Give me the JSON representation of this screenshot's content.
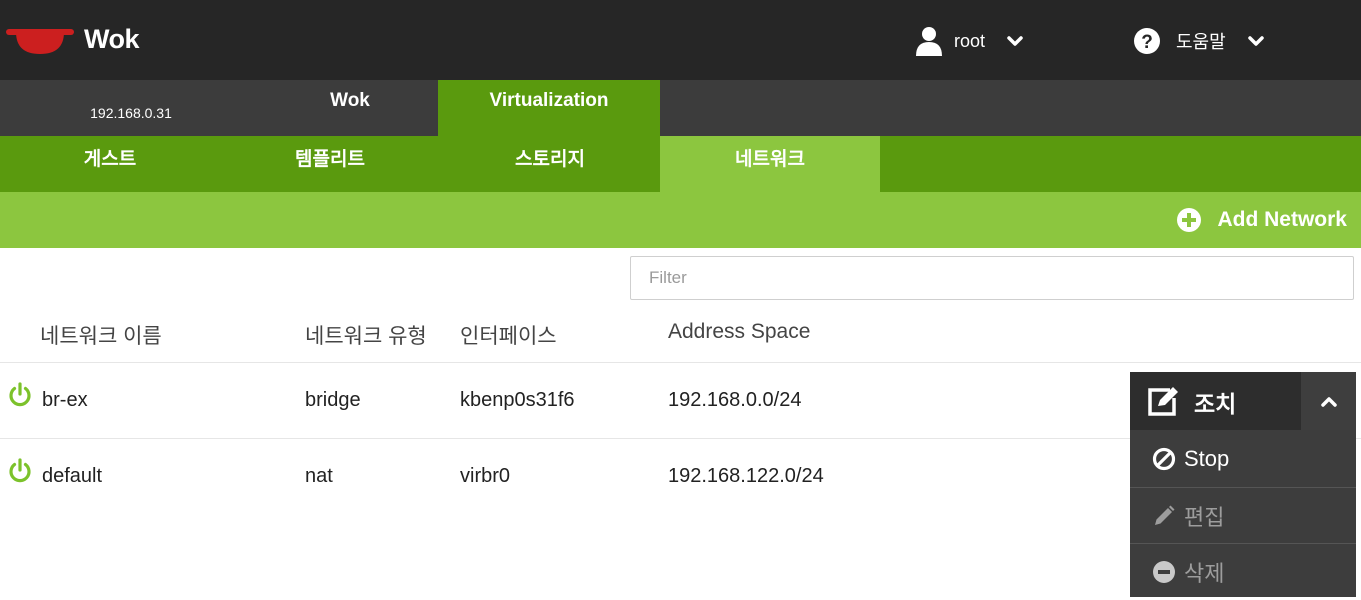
{
  "header": {
    "brand": "Wok",
    "user_label": "root",
    "help_label": "도움말"
  },
  "host_tabs": {
    "host_ip": "192.168.0.31",
    "wok": "Wok",
    "virtualization": "Virtualization"
  },
  "sub_tabs": {
    "guests": "게스트",
    "templates": "템플리트",
    "storage": "스토리지",
    "network": "네트워크"
  },
  "actions_bar": {
    "add_network": "Add Network"
  },
  "filter": {
    "placeholder": "Filter",
    "value": ""
  },
  "table": {
    "headers": {
      "name": "네트워크 이름",
      "type": "네트워크 유형",
      "interface": "인터페이스",
      "address": "Address Space"
    },
    "rows": [
      {
        "name": "br-ex",
        "type": "bridge",
        "interface": "kbenp0s31f6",
        "address": "192.168.0.0/24",
        "state": "active"
      },
      {
        "name": "default",
        "type": "nat",
        "interface": "virbr0",
        "address": "192.168.122.0/24",
        "state": "active"
      }
    ]
  },
  "actions_menu": {
    "title": "조치",
    "items": {
      "stop": "Stop",
      "edit": "편집",
      "delete": "삭제"
    }
  },
  "colors": {
    "header_bg": "#262626",
    "host_bar_bg": "#3c3c3c",
    "primary_green": "#5a9a0e",
    "light_green": "#8cc63f",
    "power_icon": "#7cc22b",
    "disabled_text": "#9d9d9d"
  }
}
